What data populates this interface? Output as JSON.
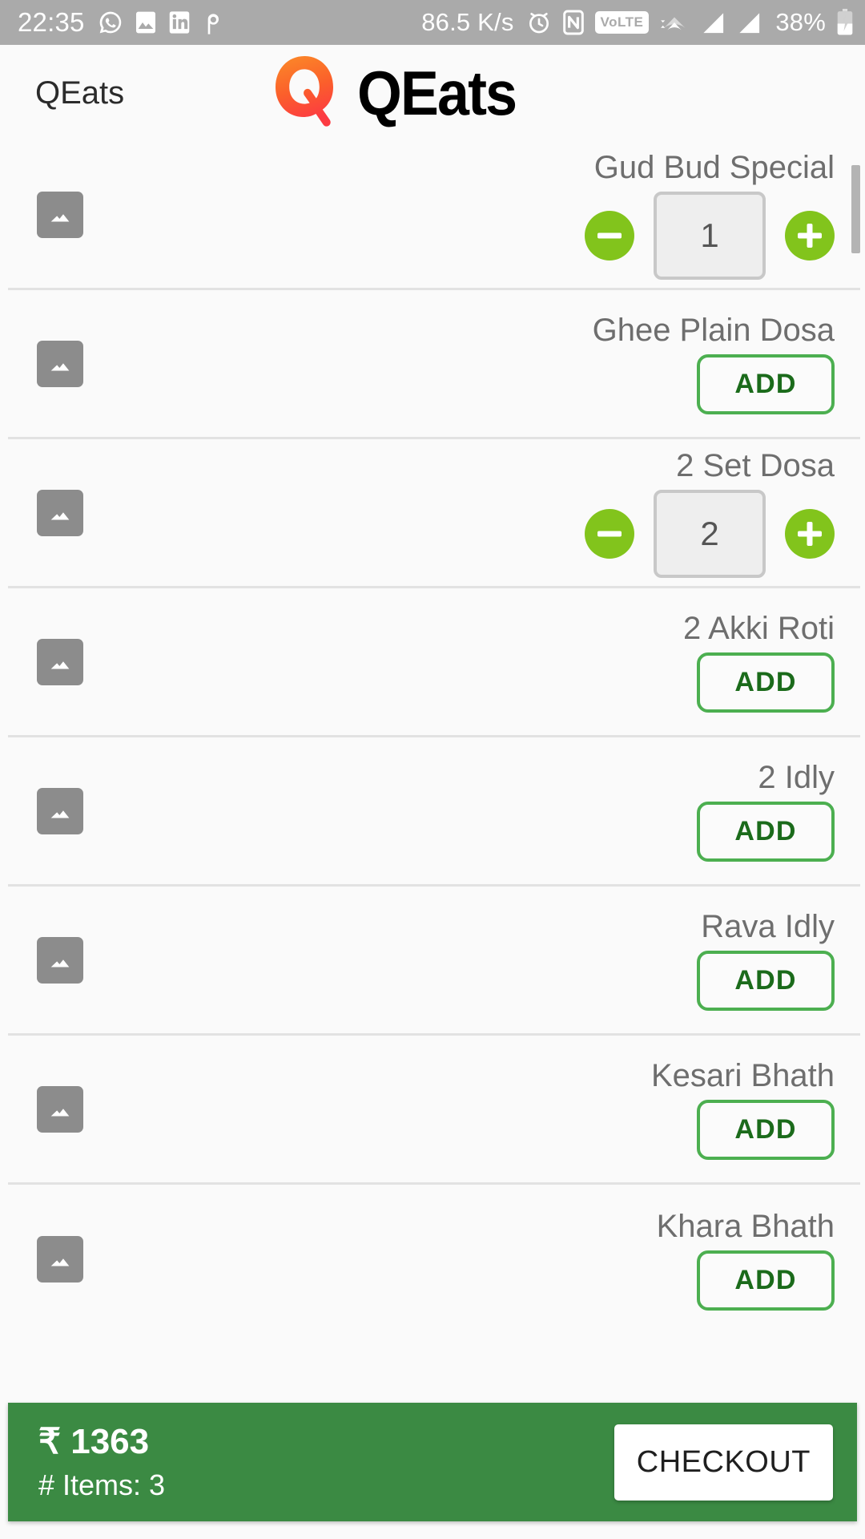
{
  "status_bar": {
    "time": "22:35",
    "network_speed": "86.5 K/s",
    "volte_label": "VoLTE",
    "battery_percent": "38%",
    "left_icons": [
      "whatsapp-icon",
      "gallery-icon",
      "linkedin-icon",
      "pinterest-icon"
    ],
    "right_icons": [
      "alarm-icon",
      "nfc-icon",
      "volte-icon",
      "wifi-icon",
      "signal-icon-1",
      "signal-icon-2",
      "battery-charging-icon"
    ],
    "background_color": "#aaaaaa"
  },
  "app_bar": {
    "title": "QEats",
    "logo_mark": "Q",
    "logo_word": "QEats",
    "logo_gradient_start": "#f98125",
    "logo_gradient_end": "#fc3d3d"
  },
  "menu": {
    "items": [
      {
        "name": "Gud Bud Special",
        "control": "stepper",
        "quantity": "1",
        "thumb": "image-placeholder-icon"
      },
      {
        "name": "Ghee Plain Dosa",
        "control": "add",
        "add_label": "ADD",
        "thumb": "image-placeholder-icon"
      },
      {
        "name": "2 Set Dosa",
        "control": "stepper",
        "quantity": "2",
        "thumb": "image-placeholder-icon"
      },
      {
        "name": "2 Akki Roti",
        "control": "add",
        "add_label": "ADD",
        "thumb": "image-placeholder-icon"
      },
      {
        "name": "2 Idly",
        "control": "add",
        "add_label": "ADD",
        "thumb": "image-placeholder-icon"
      },
      {
        "name": "Rava Idly",
        "control": "add",
        "add_label": "ADD",
        "thumb": "image-placeholder-icon"
      },
      {
        "name": "Kesari Bhath",
        "control": "add",
        "add_label": "ADD",
        "thumb": "image-placeholder-icon"
      },
      {
        "name": "Khara Bhath",
        "control": "add",
        "add_label": "ADD",
        "thumb": "image-placeholder-icon"
      }
    ],
    "add_button_border_color": "#4caf50",
    "add_button_text_color": "#1b6b1b",
    "stepper_button_color": "#82c41c"
  },
  "checkout": {
    "total": "₹ 1363",
    "items_label": "# Items: 3",
    "button_label": "CHECKOUT",
    "bar_color": "#3b8a43"
  }
}
